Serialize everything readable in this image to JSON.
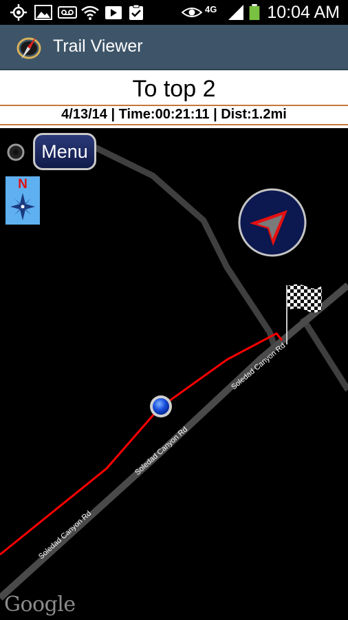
{
  "status_bar": {
    "time": "10:04 AM",
    "network": "4G",
    "icons": [
      "gps-icon",
      "gallery-icon",
      "voicemail-icon",
      "wifi-icon",
      "play-store-icon",
      "clipboard-check-icon",
      "eye-icon",
      "signal-icon",
      "battery-icon"
    ]
  },
  "app_bar": {
    "title": "Trail Viewer",
    "icon": "compass-icon"
  },
  "trail": {
    "name": "To top 2",
    "stats": "4/13/14 | Time:00:21:11 | Dist:1.2mi"
  },
  "map": {
    "menu_label": "Menu",
    "north_label": "N",
    "road_labels": [
      "Soledad Canyon Rd",
      "Soledad Canyon Rd",
      "Soledad Canyon Rd"
    ],
    "attribution": "Google",
    "colors": {
      "track": "#ff0000",
      "road": "#4a4a4a",
      "compass_bg": "#5fb0f0"
    }
  }
}
